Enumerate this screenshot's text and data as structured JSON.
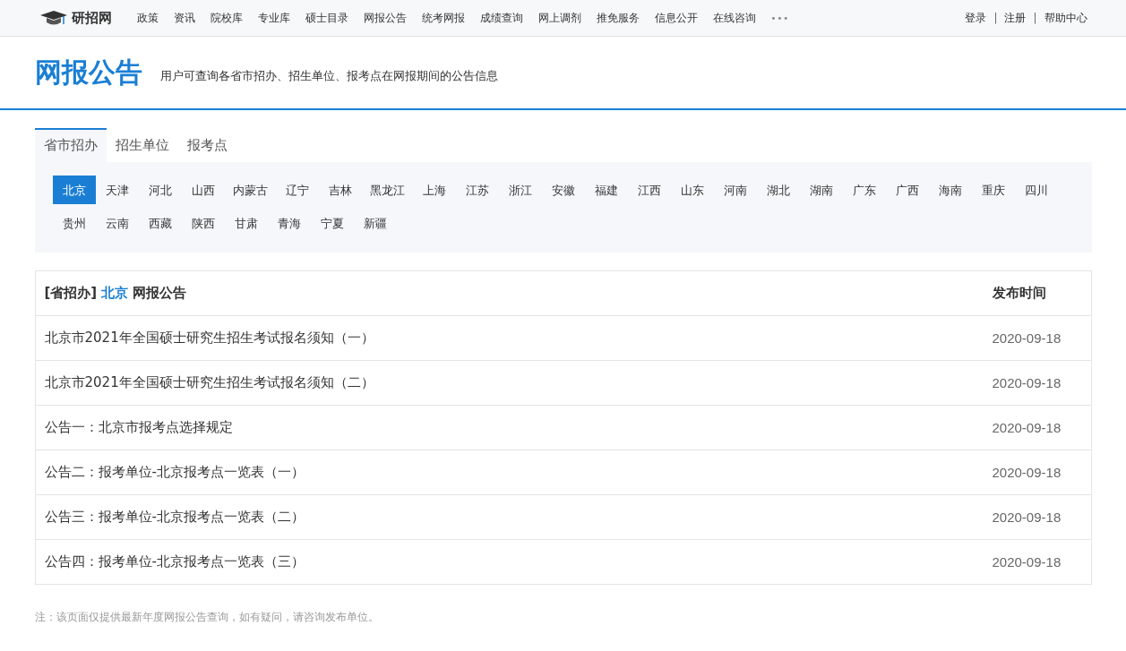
{
  "nav": {
    "logo": "研招网",
    "items": [
      "政策",
      "资讯",
      "院校库",
      "专业库",
      "硕士目录",
      "网报公告",
      "统考网报",
      "成绩查询",
      "网上调剂",
      "推免服务",
      "信息公开",
      "在线咨询"
    ],
    "more": "•••",
    "account_links": [
      "登录",
      "注册",
      "帮助中心"
    ],
    "separator": "|"
  },
  "header": {
    "title": "网报公告",
    "subtitle": "用户可查询各省市招办、招生单位、报考点在网报期间的公告信息"
  },
  "tabs": [
    {
      "label": "省市招办",
      "selected": true
    },
    {
      "label": "招生单位",
      "selected": false
    },
    {
      "label": "报考点",
      "selected": false
    }
  ],
  "provinces": [
    {
      "label": "北京",
      "selected": true
    },
    {
      "label": "天津",
      "selected": false
    },
    {
      "label": "河北",
      "selected": false
    },
    {
      "label": "山西",
      "selected": false
    },
    {
      "label": "内蒙古",
      "selected": false
    },
    {
      "label": "辽宁",
      "selected": false
    },
    {
      "label": "吉林",
      "selected": false
    },
    {
      "label": "黑龙江",
      "selected": false
    },
    {
      "label": "上海",
      "selected": false
    },
    {
      "label": "江苏",
      "selected": false
    },
    {
      "label": "浙江",
      "selected": false
    },
    {
      "label": "安徽",
      "selected": false
    },
    {
      "label": "福建",
      "selected": false
    },
    {
      "label": "江西",
      "selected": false
    },
    {
      "label": "山东",
      "selected": false
    },
    {
      "label": "河南",
      "selected": false
    },
    {
      "label": "湖北",
      "selected": false
    },
    {
      "label": "湖南",
      "selected": false
    },
    {
      "label": "广东",
      "selected": false
    },
    {
      "label": "广西",
      "selected": false
    },
    {
      "label": "海南",
      "selected": false
    },
    {
      "label": "重庆",
      "selected": false
    },
    {
      "label": "四川",
      "selected": false
    },
    {
      "label": "贵州",
      "selected": false
    },
    {
      "label": "云南",
      "selected": false
    },
    {
      "label": "西藏",
      "selected": false
    },
    {
      "label": "陕西",
      "selected": false
    },
    {
      "label": "甘肃",
      "selected": false
    },
    {
      "label": "青海",
      "selected": false
    },
    {
      "label": "宁夏",
      "selected": false
    },
    {
      "label": "新疆",
      "selected": false
    }
  ],
  "table": {
    "heading": {
      "category": "[省招办]",
      "region": "北京",
      "suffix": "网报公告"
    },
    "date_column": "发布时间",
    "rows": [
      {
        "title": "北京市2021年全国硕士研究生招生考试报名须知（一）",
        "date": "2020-09-18"
      },
      {
        "title": "北京市2021年全国硕士研究生招生考试报名须知（二）",
        "date": "2020-09-18"
      },
      {
        "title": "公告一：北京市报考点选择规定",
        "date": "2020-09-18"
      },
      {
        "title": "公告二：报考单位-北京报考点一览表（一）",
        "date": "2020-09-18"
      },
      {
        "title": "公告三：报考单位-北京报考点一览表（二）",
        "date": "2020-09-18"
      },
      {
        "title": "公告四：报考单位-北京报考点一览表（三）",
        "date": "2020-09-18"
      }
    ]
  },
  "note": "注：该页面仅提供最新年度网报公告查询，如有疑问，请咨询发布单位。"
}
